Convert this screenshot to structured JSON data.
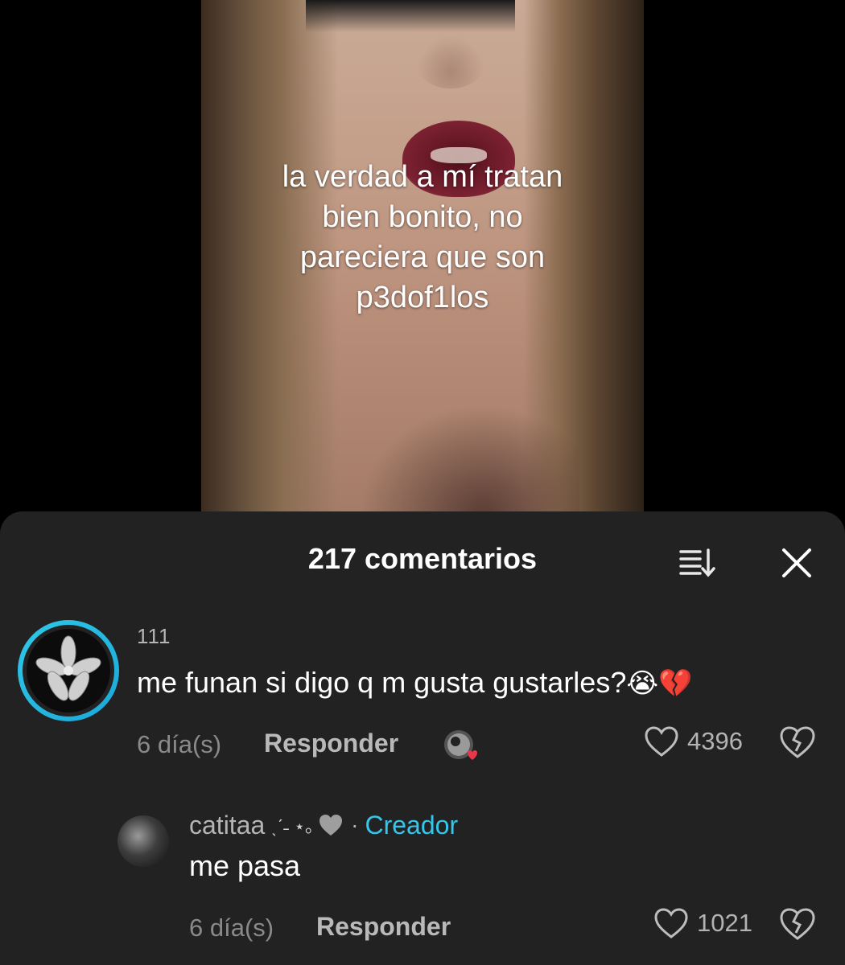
{
  "video": {
    "caption_lines": [
      "la verdad a mí tratan",
      "bien bonito, no",
      "pareciera que son",
      "p3dof1los"
    ]
  },
  "sheet": {
    "title": "217 comentarios",
    "sort_icon": "sort-icon",
    "close_icon": "close-icon"
  },
  "comments": [
    {
      "username": "111",
      "text": "me funan si digo q m gusta gustarles?",
      "emojis": [
        "😭",
        "💔"
      ],
      "time": "6 día(s)",
      "reply_label": "Responder",
      "likes": "4396",
      "creator_liked": true
    }
  ],
  "replies": [
    {
      "username": "catitaa",
      "username_decoration": "ˎˊ˗ ⋆｡",
      "badge_separator": "·",
      "badge": "Creador",
      "text": "me pasa",
      "time": "6 día(s)",
      "reply_label": "Responder",
      "likes": "1021"
    }
  ],
  "colors": {
    "sheet_bg": "#222223",
    "creator_badge": "#34c6eb",
    "avatar_ring": "#2fc9e8",
    "like_heart_red": "#e8364b"
  }
}
